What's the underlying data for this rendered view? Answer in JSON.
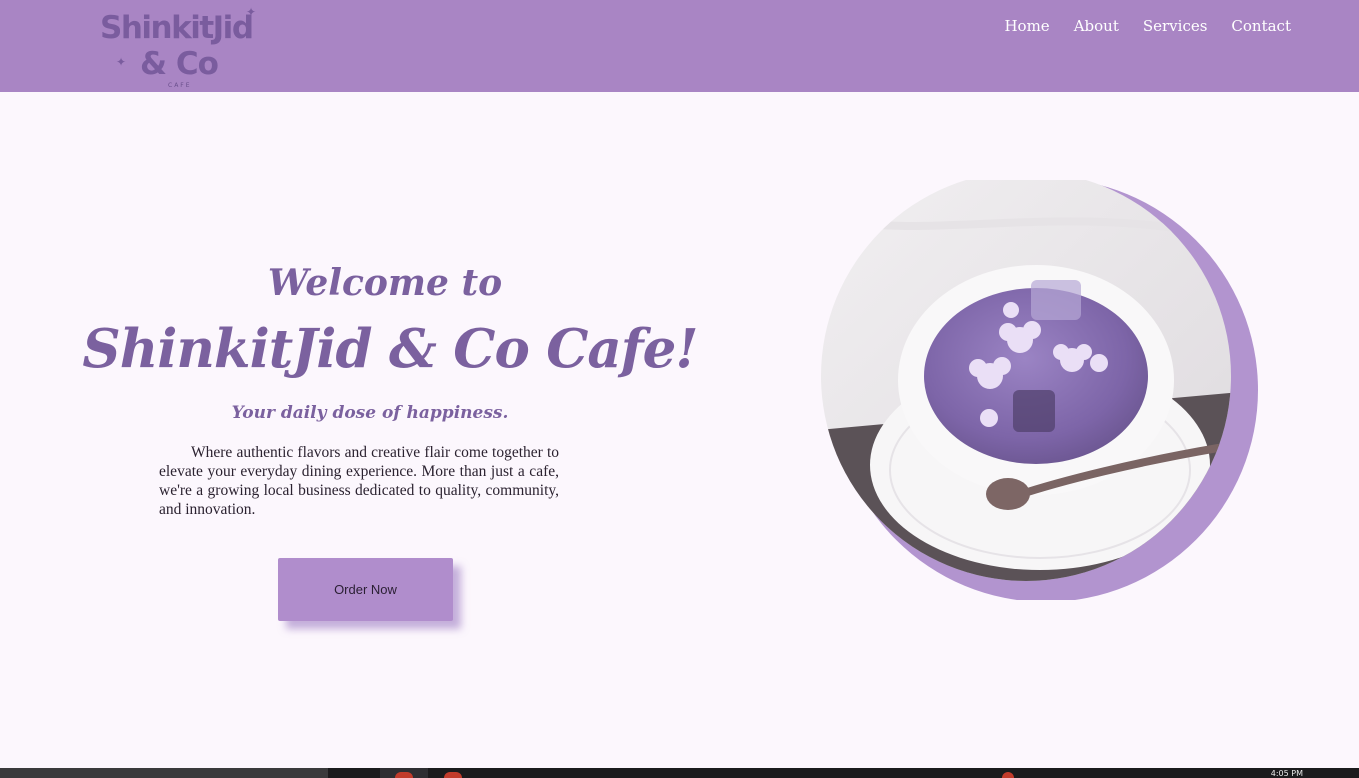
{
  "header": {
    "logo": {
      "line1": "ShinkitJid",
      "line2": "& Co",
      "line3": "CAFE",
      "sparkle": "✦"
    },
    "nav": [
      {
        "label": "Home"
      },
      {
        "label": "About"
      },
      {
        "label": "Services"
      },
      {
        "label": "Contact"
      }
    ]
  },
  "hero": {
    "welcome": "Welcome to",
    "cafe_name": "ShinkitJid & Co Cafe!",
    "tagline": "Your daily dose of happiness.",
    "description": "Where authentic flavors and creative flair come together to elevate your everyday dining experience. More than just a cafe, we're a growing local business dedicated to quality, community, and innovation.",
    "cta_label": "Order Now"
  },
  "taskbar": {
    "time": "4:05 PM"
  },
  "colors": {
    "navbar": "#a985c4",
    "heading": "#7b619f",
    "page_bg": "#fcf7fd",
    "button": "#b08dcc",
    "accent_ring": "#b294cf"
  }
}
